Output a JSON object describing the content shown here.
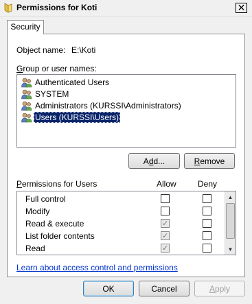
{
  "window": {
    "title": "Permissions for Koti",
    "close_glyph": "✕"
  },
  "tabs": [
    {
      "label": "Security"
    }
  ],
  "object": {
    "label": "Object name:",
    "value": "E:\\Koti"
  },
  "users": {
    "label": "Group or user names:",
    "items": [
      {
        "label": "Authenticated Users",
        "selected": false
      },
      {
        "label": "SYSTEM",
        "selected": false
      },
      {
        "label": "Administrators (KURSSI\\Administrators)",
        "selected": false
      },
      {
        "label": "Users (KURSSI\\Users)",
        "selected": true
      }
    ]
  },
  "buttons": {
    "add": "Add...",
    "remove": "Remove",
    "ok": "OK",
    "cancel": "Cancel",
    "apply": "Apply"
  },
  "permissions": {
    "header": "Permissions for Users",
    "allow_label": "Allow",
    "deny_label": "Deny",
    "rows": [
      {
        "name": "Full control",
        "allow": false,
        "allow_disabled": false,
        "deny": false
      },
      {
        "name": "Modify",
        "allow": false,
        "allow_disabled": false,
        "deny": false
      },
      {
        "name": "Read & execute",
        "allow": true,
        "allow_disabled": true,
        "deny": false
      },
      {
        "name": "List folder contents",
        "allow": true,
        "allow_disabled": true,
        "deny": false
      },
      {
        "name": "Read",
        "allow": true,
        "allow_disabled": true,
        "deny": false
      }
    ]
  },
  "link": {
    "label": "Learn about access control and permissions"
  },
  "colors": {
    "selection": "#0a246a",
    "link": "#0033cc",
    "folder": "#e8c24a"
  }
}
